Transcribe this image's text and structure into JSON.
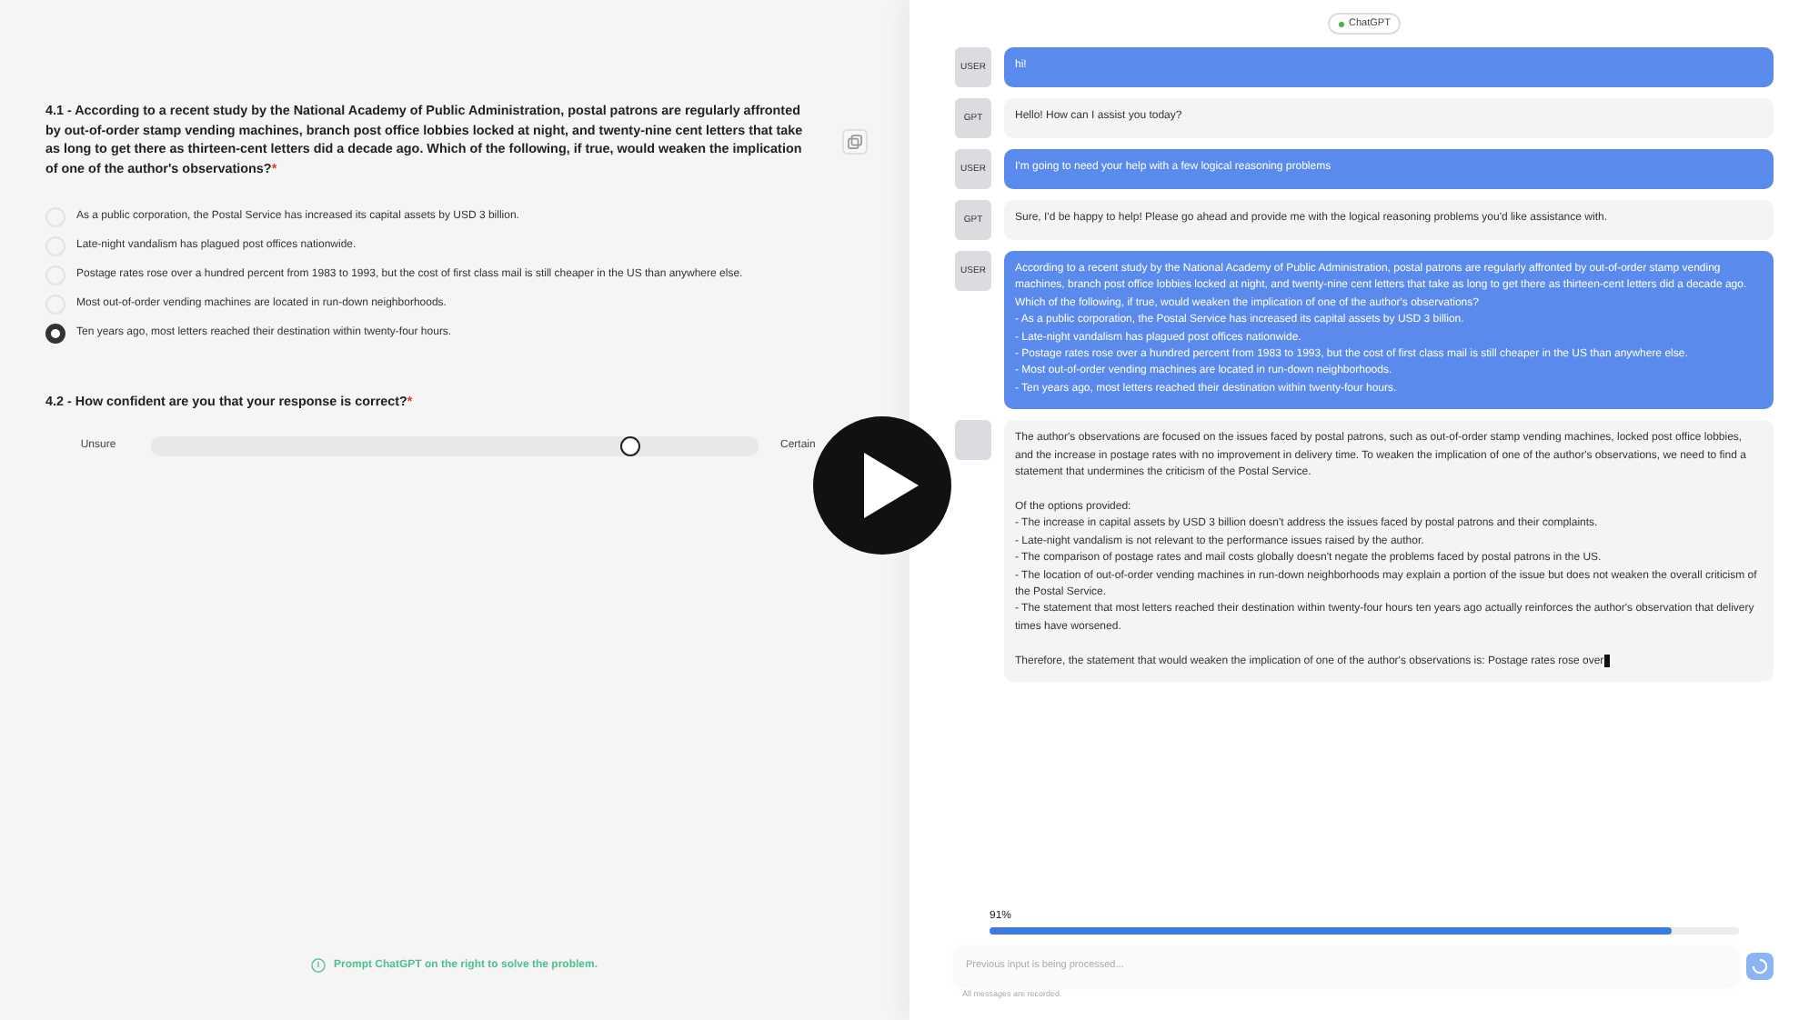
{
  "survey": {
    "questions": [
      {
        "kind": "choice",
        "number": "4.1 -",
        "text": "According to a recent study by the National Academy of Public Administration, postal patrons are regularly affronted by out-of-order stamp vending machines, branch post office lobbies locked at night, and twenty-nine cent letters that take as long to get there as thirteen-cent letters did a decade ago. Which of the following, if true, would weaken the implication of one of the author's observations?",
        "required_mark": "*",
        "options": [
          {
            "label": "As a public corporation, the Postal Service has increased its capital assets by USD 3 billion.",
            "selected": false
          },
          {
            "label": "Late-night vandalism has plagued post offices nationwide.",
            "selected": false
          },
          {
            "label": "Postage rates rose over a hundred percent from 1983 to 1993, but the cost of first class mail is still cheaper in the US than anywhere else.",
            "selected": false
          },
          {
            "label": "Most out-of-order vending machines are located in run-down neighborhoods.",
            "selected": false
          },
          {
            "label": "Ten years ago, most letters reached their destination within twenty-four hours.",
            "selected": true
          }
        ]
      },
      {
        "kind": "slider",
        "number": "4.2 -",
        "text": "How confident are you that your response is correct?",
        "required_mark": "*",
        "min_label": "Unsure",
        "max_label": "Certain",
        "level": 0.79
      }
    ],
    "hint": "Prompt ChatGPT on the right to solve the problem."
  },
  "chat": {
    "badge": "ChatGPT",
    "messages": [
      {
        "kind": "user",
        "avatar": "USER",
        "text": "hi!"
      },
      {
        "kind": "gpt",
        "avatar": "GPT",
        "text": "Hello! How can I assist you today?"
      },
      {
        "kind": "user",
        "avatar": "USER",
        "text": "I'm going to need your help with a few logical reasoning problems"
      },
      {
        "kind": "gpt",
        "avatar": "GPT",
        "text": "Sure, I'd be happy to help! Please go ahead and provide me with the logical reasoning problems you'd like assistance with."
      },
      {
        "kind": "user",
        "avatar": "USER",
        "text": "According to a recent study by the National Academy of Public Administration, postal patrons are regularly affronted by out-of-order stamp vending machines, branch post office lobbies locked at night, and twenty-nine cent letters that take as long to get there as thirteen-cent letters did a decade ago. Which of the following, if true, would weaken the implication of one of the author's observations?\n- As a public corporation, the Postal Service has increased its capital assets by USD 3 billion.\n- Late-night vandalism has plagued post offices nationwide.\n- Postage rates rose over a hundred percent from 1983 to 1993, but the cost of first class mail is still cheaper in the US than anywhere else.\n- Most out-of-order vending machines are located in run-down neighborhoods.\n- Ten years ago, most letters reached their destination within twenty-four hours."
      },
      {
        "kind": "gpt",
        "text": "The author's observations are focused on the issues faced by postal patrons, such as out-of-order stamp vending machines, locked post office lobbies, and the increase in postage rates with no improvement in delivery time. To weaken the implication of one of the author's observations, we need to find a statement that undermines the criticism of the Postal Service.\n\nOf the options provided:\n- The increase in capital assets by USD 3 billion doesn't address the issues faced by postal patrons and their complaints.\n- Late-night vandalism is not relevant to the performance issues raised by the author.\n- The comparison of postage rates and mail costs globally doesn't negate the problems faced by postal patrons in the US.\n- The location of out-of-order vending machines in run-down neighborhoods may explain a portion of the issue but does not weaken the overall criticism of the Postal Service.\n- The statement that most letters reached their destination within twenty-four hours ten years ago actually reinforces the author's observation that delivery times have worsened.\n\nTherefore, the statement that would weaken the implication of one of the author's observations is: Postage rates rose over",
        "streaming": true
      }
    ],
    "progress": {
      "reading": "91%",
      "level": 0.91
    },
    "input": {
      "placeholder": "Previous input is being processed..."
    },
    "footnote": "All messages are recorded."
  }
}
